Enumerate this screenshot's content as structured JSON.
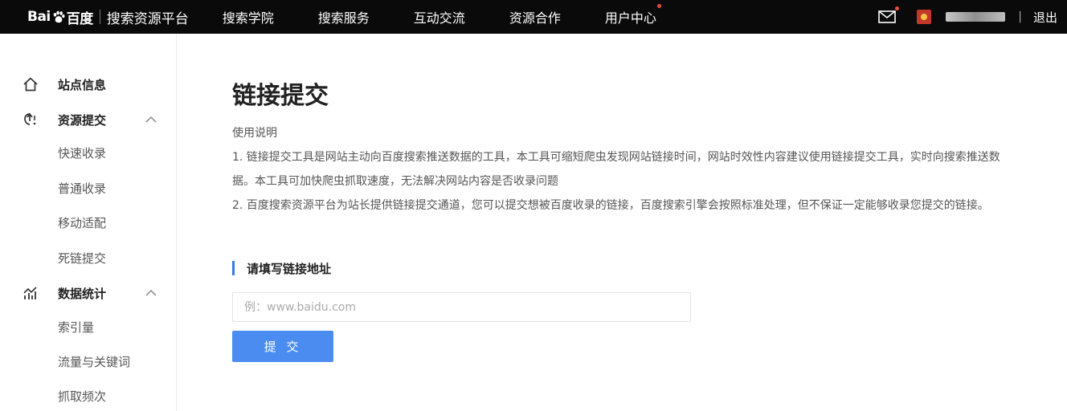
{
  "header": {
    "logo_left": "Bai",
    "logo_right": "百度",
    "platform_title": "搜索资源平台",
    "nav": [
      {
        "label": "搜索学院"
      },
      {
        "label": "搜索服务"
      },
      {
        "label": "互动交流"
      },
      {
        "label": "资源合作"
      },
      {
        "label": "用户中心"
      }
    ],
    "separator": "|",
    "logout": "退出",
    "icons": [
      "mail-icon",
      "user-avatar"
    ],
    "colors": {
      "background": "#0a0a0a",
      "badge": "#e84c3d"
    }
  },
  "sidebar": {
    "groups": [
      {
        "label": "站点信息",
        "icon": "home-icon",
        "items": []
      },
      {
        "label": "资源提交",
        "icon": "submit-icon",
        "expanded": true,
        "items": [
          "快速收录",
          "普通收录",
          "移动适配",
          "死链提交"
        ]
      },
      {
        "label": "数据统计",
        "icon": "stats-icon",
        "expanded": true,
        "items": [
          "索引量",
          "流量与关键词",
          "抓取频次"
        ]
      }
    ]
  },
  "main": {
    "title": "链接提交",
    "usage_label": "使用说明",
    "desc1_line1": "1. 链接提交工具是网站主动向百度搜索推送数据的工具，本工具可缩短爬虫发现网站链接时间，网站时效性内容建议使用链接提交工具，实时向搜索推送数",
    "desc1_line2": "据。本工具可加快爬虫抓取速度，无法解决网站内容是否收录问题",
    "desc2": "2. 百度搜索资源平台为站长提供链接提交通道，您可以提交想被百度收录的链接，百度搜索引擎会按照标准处理，但不保证一定能够收录您提交的链接。",
    "section_title": "请填写链接地址",
    "url_input": {
      "value": "",
      "placeholder": "例：www.baidu.com"
    },
    "submit_label": "提 交",
    "colors": {
      "accent": "#4b8cf0",
      "section_bar": "#3a7be0"
    }
  }
}
